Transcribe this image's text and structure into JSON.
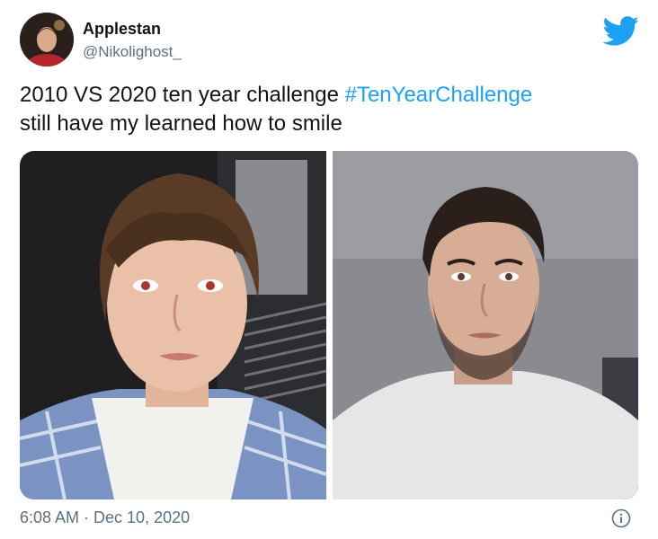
{
  "tweet": {
    "author": {
      "display_name": "Applestan",
      "handle": "@Nikolighost_",
      "avatar_icon": "profile-avatar"
    },
    "text_line1_plain": "2010 VS 2020 ten year challenge ",
    "text_line1_hashtag": "#TenYearChallenge",
    "text_line2": "still have my learned how to smile",
    "timestamp": "6:08 AM · Dec 10, 2020",
    "media": [
      {
        "subject": "teen-portrait-2010"
      },
      {
        "subject": "adult-portrait-2020"
      }
    ]
  },
  "colors": {
    "brand": "#1da1f2",
    "text": "#0f1419",
    "secondary_text": "#5b7083"
  },
  "icons": {
    "brand": "twitter-bird-icon",
    "info": "info-icon"
  }
}
